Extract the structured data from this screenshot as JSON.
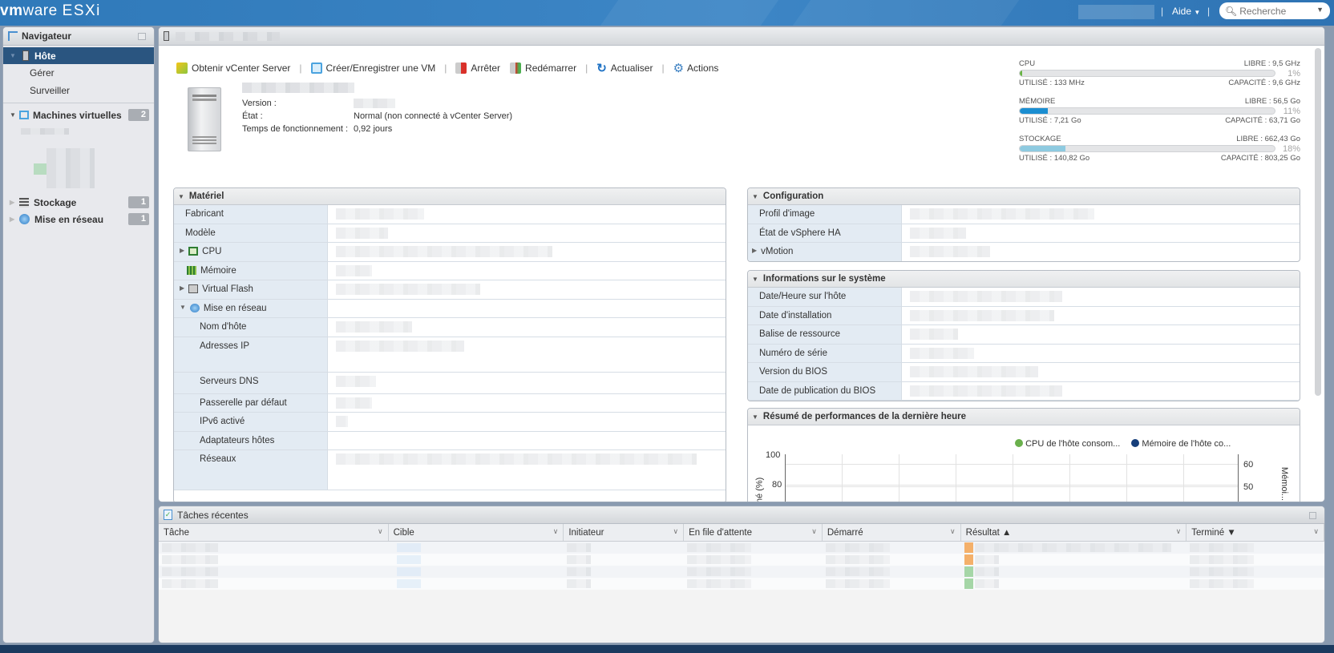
{
  "header": {
    "brand_vm": "vm",
    "brand_ware": "ware",
    "product": "ESXi",
    "help_label": "Aide",
    "search_placeholder": "Recherche"
  },
  "navigator": {
    "title": "Navigateur",
    "host": {
      "label": "Hôte",
      "children": [
        "Gérer",
        "Surveiller"
      ]
    },
    "sections": [
      {
        "label": "Machines virtuelles",
        "count": "2",
        "icon": "vm-icon"
      },
      {
        "label": "Stockage",
        "count": "1",
        "icon": "storage-icon"
      },
      {
        "label": "Mise en réseau",
        "count": "1",
        "icon": "network-icon"
      }
    ]
  },
  "toolbar": {
    "items": [
      {
        "label": "Obtenir vCenter Server",
        "icon": "vcenter-icon",
        "color": "#8cc63f"
      },
      {
        "label": "Créer/Enregistrer une VM",
        "icon": "create-vm-icon",
        "color": "#4aa3df"
      },
      {
        "label": "Arrêter",
        "icon": "shutdown-icon",
        "color": "#d9312a"
      },
      {
        "label": "Redémarrer",
        "icon": "reboot-icon",
        "color": "#d9312a"
      },
      {
        "label": "Actualiser",
        "icon": "refresh-icon",
        "color": "#1f72c4"
      },
      {
        "label": "Actions",
        "icon": "gear-icon",
        "color": "#3a7fc1"
      }
    ]
  },
  "host_info": {
    "version_label": "Version :",
    "state_label": "État :",
    "state_value": "Normal (non connecté à vCenter Server)",
    "uptime_label": "Temps de fonctionnement :",
    "uptime_value": "0,92 jours"
  },
  "resources": [
    {
      "name": "CPU",
      "free": "LIBRE : 9,5 GHz",
      "used": "UTILISÉ : 133 MHz",
      "capacity": "CAPACITÉ : 9,6 GHz",
      "percent": 1,
      "percent_label": "1%",
      "color": "#67b343"
    },
    {
      "name": "MÉMOIRE",
      "free": "LIBRE : 56,5 Go",
      "used": "UTILISÉ : 7,21 Go",
      "capacity": "CAPACITÉ : 63,71 Go",
      "percent": 11,
      "percent_label": "11%",
      "color": "#1b8ed1"
    },
    {
      "name": "STOCKAGE",
      "free": "LIBRE : 662,43 Go",
      "used": "UTILISÉ : 140,82 Go",
      "capacity": "CAPACITÉ : 803,25 Go",
      "percent": 18,
      "percent_label": "18%",
      "color": "#8ecae0"
    }
  ],
  "hardware": {
    "title": "Matériel",
    "rows": [
      "Fabricant",
      "Modèle",
      "CPU",
      "Mémoire",
      "Virtual Flash",
      "Mise en réseau",
      "Nom d'hôte",
      "Adresses IP",
      "Serveurs DNS",
      "Passerelle par défaut",
      "IPv6 activé",
      "Adaptateurs hôtes",
      "Réseaux"
    ]
  },
  "configuration": {
    "title": "Configuration",
    "rows": [
      "Profil d'image",
      "État de vSphere HA",
      "vMotion"
    ]
  },
  "system_info": {
    "title": "Informations sur le système",
    "rows": [
      "Date/Heure sur l'hôte",
      "Date d'installation",
      "Balise de ressource",
      "Numéro de série",
      "Version du BIOS",
      "Date de publication du BIOS"
    ]
  },
  "performance": {
    "title": "Résumé de performances de la dernière heure",
    "legend": [
      {
        "label": "CPU de l'hôte consom...",
        "color": "#6ab04c"
      },
      {
        "label": "Mémoire de l'hôte co...",
        "color": "#163e7a"
      }
    ],
    "left_axis_label": "...mé (%)",
    "left_ticks": [
      "100",
      "80"
    ],
    "right_axis_label": "Mémoi...",
    "right_ticks": [
      "60",
      "50"
    ]
  },
  "tasks": {
    "title": "Tâches récentes",
    "columns": [
      "Tâche",
      "Cible",
      "Initiateur",
      "En file d'attente",
      "Démarré",
      "Résultat ▲",
      "Terminé ▼"
    ]
  }
}
